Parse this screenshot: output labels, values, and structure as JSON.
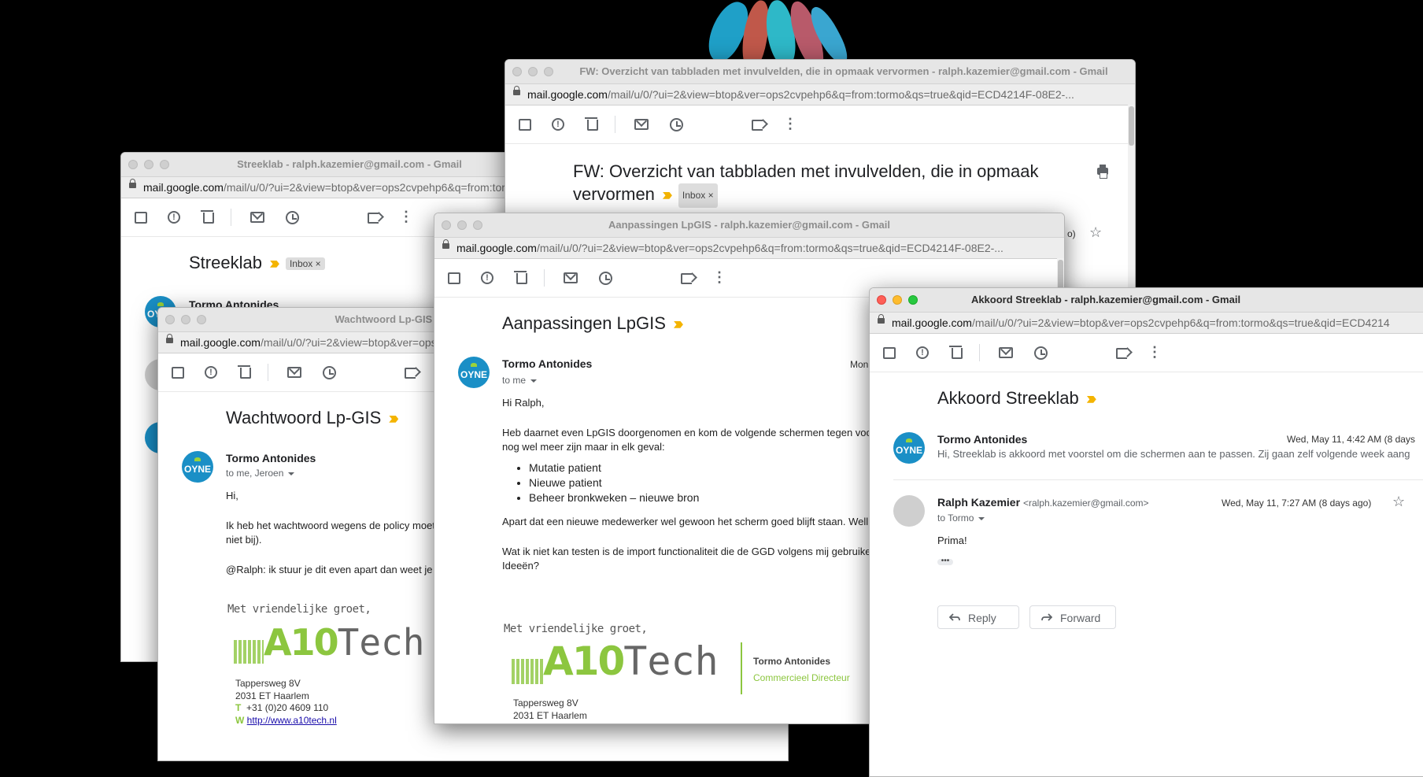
{
  "win_streeklab": {
    "title": "Streeklab - ralph.kazemier@gmail.com - Gmail",
    "url_host": "mail.google.com",
    "url_path": "/mail/u/0/?ui=2&view=btop&ver=ops2cvpehp6&q=from:tormo&qs=true&qid=ECD4214F-08E2-...",
    "subject": "Streeklab",
    "label": "Inbox",
    "sender": "Tormo Antonides"
  },
  "win_wachtwoord": {
    "title": "Wachtwoord Lp-GIS - ralph.kazemier@gmail.com - Gmail",
    "url_host": "mail.google.com",
    "url_path": "/mail/u/0/?ui=2&view=btop&ver=ops2cvpehp6&q=from:tormo&qs=true",
    "subject": "Wachtwoord Lp-GIS",
    "sender": "Tormo Antonides",
    "to": "to me, Jeroen",
    "body_lines": [
      "Hi,",
      "Ik heb het wachtwoord wegens de policy moet",
      "niet bij).",
      "@Ralph: ik stuur je dit even apart dan weet je"
    ],
    "greeting": "Met vriendelijke groet,",
    "logo_a10": "A10",
    "logo_tech": "Tech",
    "address": [
      "Tappersweg 8V",
      "2031 ET Haarlem"
    ],
    "phone_label": "T",
    "phone": "+31 (0)20 4609 110",
    "web_label": "W",
    "web": "http://www.a10tech.nl"
  },
  "win_fw": {
    "title": "FW: Overzicht van tabbladen met invulvelden, die in opmaak vervormen - ralph.kazemier@gmail.com - Gmail",
    "url_host": "mail.google.com",
    "url_path": "/mail/u/0/?ui=2&view=btop&ver=ops2cvpehp6&q=from:tormo&qs=true&qid=ECD4214F-08E2-...",
    "subject_line1": "FW: Overzicht van tabbladen met invulvelden, die in opmaak",
    "subject_line2": "vervormen",
    "label": "Inbox",
    "partial": "o)"
  },
  "win_aanpassingen": {
    "title": "Aanpassingen LpGIS - ralph.kazemier@gmail.com - Gmail",
    "url_host": "mail.google.com",
    "url_path": "/mail/u/0/?ui=2&view=btop&ver=ops2cvpehp6&q=from:tormo&qs=true&qid=ECD4214F-08E2-...",
    "subject": "Aanpassingen LpGIS",
    "sender": "Tormo Antonides",
    "to": "to me",
    "date": "Mon,",
    "body_greeting": "Hi Ralph,",
    "body_p1": "Heb daarnet even LpGIS doorgenomen en kom de volgende schermen tegen voo",
    "body_p1b": "nog wel meer zijn maar in elk geval:",
    "bullets": [
      "Mutatie patient",
      "Nieuwe patient",
      "Beheer bronkweken – nieuwe bron"
    ],
    "body_p2": "Apart dat een nieuwe medewerker wel gewoon het scherm goed blijft staan. Well",
    "body_p3": "Wat ik niet kan testen is de import functionaliteit die de GGD volgens mij gebruike",
    "body_p3b": "Ideeën?",
    "greeting": "Met vriendelijke groet,",
    "logo_a10": "A10",
    "logo_tech": "Tech",
    "sig_name": "Tormo Antonides",
    "sig_role": "Commercieel Directeur",
    "address": [
      "Tappersweg 8V",
      "2031 ET Haarlem"
    ]
  },
  "win_akkoord": {
    "title": "Akkoord Streeklab - ralph.kazemier@gmail.com - Gmail",
    "url_host": "mail.google.com",
    "url_path": "/mail/u/0/?ui=2&view=btop&ver=ops2cvpehp6&q=from:tormo&qs=true&qid=ECD4214",
    "subject": "Akkoord Streeklab",
    "msg1_sender": "Tormo Antonides",
    "msg1_date": "Wed, May 11, 4:42 AM (8 days",
    "msg1_snippet": "Hi, Streeklab is akkoord met voorstel om die schermen aan te passen. Zij gaan zelf volgende week aang",
    "msg2_sender": "Ralph Kazemier",
    "msg2_addr": "<ralph.kazemier@gmail.com>",
    "msg2_date": "Wed, May 11, 7:27 AM (8 days ago)",
    "msg2_to": "to Tormo",
    "msg2_body": "Prima!",
    "reply_label": "Reply",
    "forward_label": "Forward"
  },
  "avatar_text": "OYNE",
  "icons": [
    "lock-icon",
    "archive-icon",
    "spam-icon",
    "trash-icon",
    "mail-icon",
    "snooze-icon",
    "label-icon",
    "more-icon",
    "star-icon",
    "print-icon",
    "reply-icon",
    "forward-icon"
  ]
}
